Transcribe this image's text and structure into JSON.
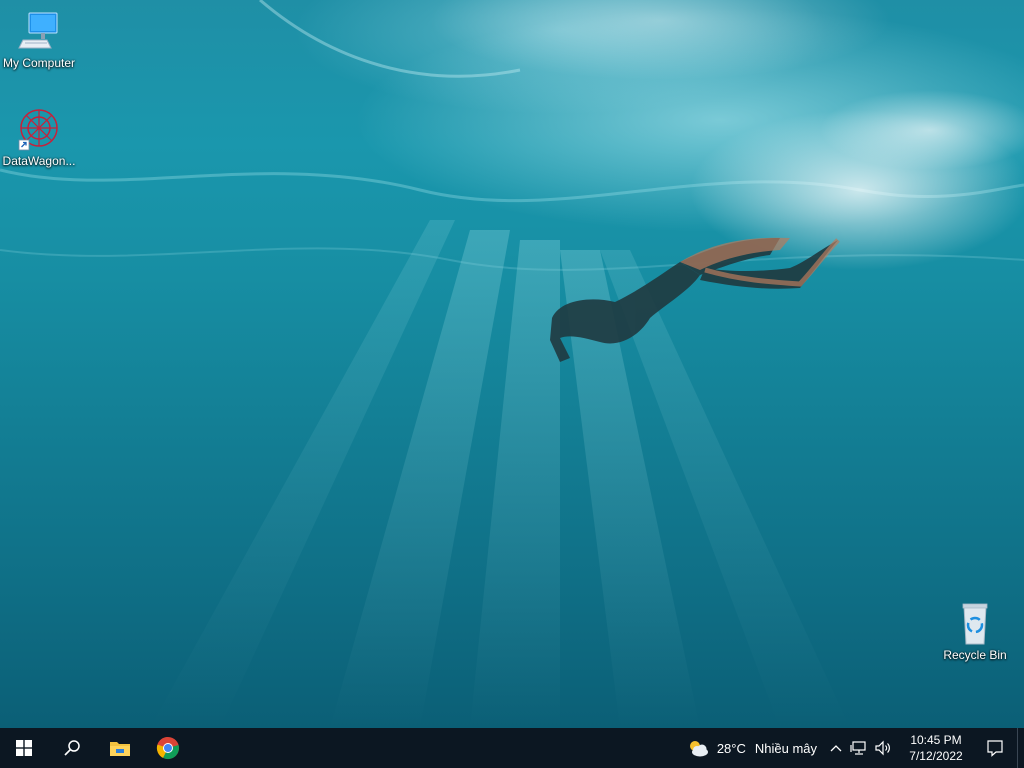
{
  "desktop": {
    "icons": [
      {
        "label": "My Computer",
        "icon": "monitor-icon"
      },
      {
        "label": "DataWagon...",
        "icon": "datawagon-icon"
      },
      {
        "label": "Recycle Bin",
        "icon": "recycle-bin-icon"
      }
    ],
    "wallpaper": "underwater-freediver"
  },
  "taskbar": {
    "start_icon": "windows-logo-icon",
    "search_icon": "search-icon",
    "pinned": [
      {
        "name": "File Explorer",
        "icon": "folder-icon"
      },
      {
        "name": "Google Chrome",
        "icon": "chrome-icon"
      }
    ],
    "weather": {
      "icon": "partly-cloudy-icon",
      "temperature": "28°C",
      "condition": "Nhiều mây"
    },
    "tray_icons": [
      "chevron-up-icon",
      "network-icon",
      "volume-icon"
    ],
    "clock": {
      "time": "10:45 PM",
      "date": "7/12/2022"
    },
    "notification_icon": "notification-icon"
  },
  "colors": {
    "taskbar_bg": "#0c1722",
    "water_top": "#1f8fa6",
    "water_bottom": "#0b5f76"
  }
}
